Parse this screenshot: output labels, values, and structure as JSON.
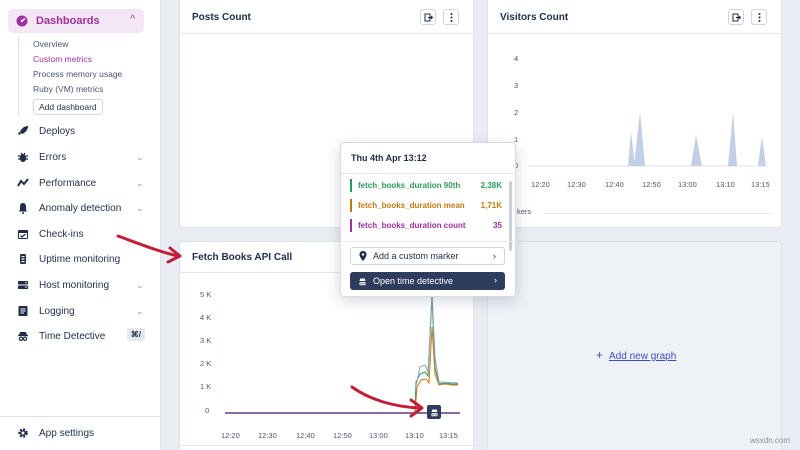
{
  "sidebar": {
    "dashboards": {
      "label": "Dashboards",
      "icon": "dashboard-icon"
    },
    "subitems": [
      {
        "label": "Overview",
        "active": false
      },
      {
        "label": "Custom metrics",
        "active": true
      },
      {
        "label": "Process memory usage",
        "active": false
      },
      {
        "label": "Ruby (VM) metrics",
        "active": false
      }
    ],
    "add_dashboard": "Add dashboard",
    "items": [
      {
        "label": "Deploys",
        "icon": "rocket-icon",
        "chevron": false
      },
      {
        "label": "Errors",
        "icon": "bug-icon",
        "chevron": true
      },
      {
        "label": "Performance",
        "icon": "performance-icon",
        "chevron": true
      },
      {
        "label": "Anomaly detection",
        "icon": "bell-icon",
        "chevron": true
      },
      {
        "label": "Check-ins",
        "icon": "calendar-icon",
        "chevron": false
      },
      {
        "label": "Uptime monitoring",
        "icon": "uptime-icon",
        "chevron": false
      },
      {
        "label": "Host monitoring",
        "icon": "server-icon",
        "chevron": true
      },
      {
        "label": "Logging",
        "icon": "log-icon",
        "chevron": true
      },
      {
        "label": "Time Detective",
        "icon": "detective-icon",
        "shortcut": "⌘/"
      }
    ],
    "app_settings": "App settings"
  },
  "panels": {
    "posts": {
      "title": "Posts Count"
    },
    "visitors": {
      "title": "Visitors Count",
      "legend_fragment": "kers",
      "chart_data": {
        "type": "area",
        "x": [
          "12:20",
          "12:30",
          "12:40",
          "12:50",
          "13:00",
          "13:10",
          "13:15"
        ],
        "yticks": [
          0,
          1,
          2,
          3,
          4
        ],
        "ylim": [
          0,
          4
        ],
        "color": "#b9c7e2"
      }
    },
    "fetch": {
      "title": "Fetch Books API Call",
      "chart_data": {
        "type": "line",
        "x": [
          "12:20",
          "12:30",
          "12:40",
          "12:50",
          "13:00",
          "13:10",
          "13:15"
        ],
        "yticks": [
          "0",
          "1 K",
          "2 K",
          "3 K",
          "4 K",
          "5 K"
        ],
        "ylim": [
          0,
          5000
        ],
        "series": [
          {
            "name": "fetch_books_duration 90th",
            "color": "#2e9a5c"
          },
          {
            "name": "fetch_books_duration mean",
            "color": "#c47a12"
          },
          {
            "name": "fetch_books_duration count",
            "color": "#a0309d"
          }
        ]
      }
    },
    "add_graph": "Add new graph"
  },
  "tooltip": {
    "title": "Thu 4th Apr 13:12",
    "rows": [
      {
        "name": "fetch_books_duration 90th",
        "value": "2,38K",
        "color": "#2e9a5c"
      },
      {
        "name": "fetch_books_duration mean",
        "value": "1,71K",
        "color": "#c47a12"
      },
      {
        "name": "fetch_books_duration count",
        "value": "35",
        "color": "#a0309d"
      }
    ],
    "add_marker": "Add a custom marker",
    "time_detective": "Open time detective"
  },
  "watermark": "wsxdn.com",
  "colors": {
    "accent": "#a0309d",
    "annotation_red": "#c41d3a",
    "dark_button": "#2e3c5e",
    "link": "#3b4fc4"
  }
}
